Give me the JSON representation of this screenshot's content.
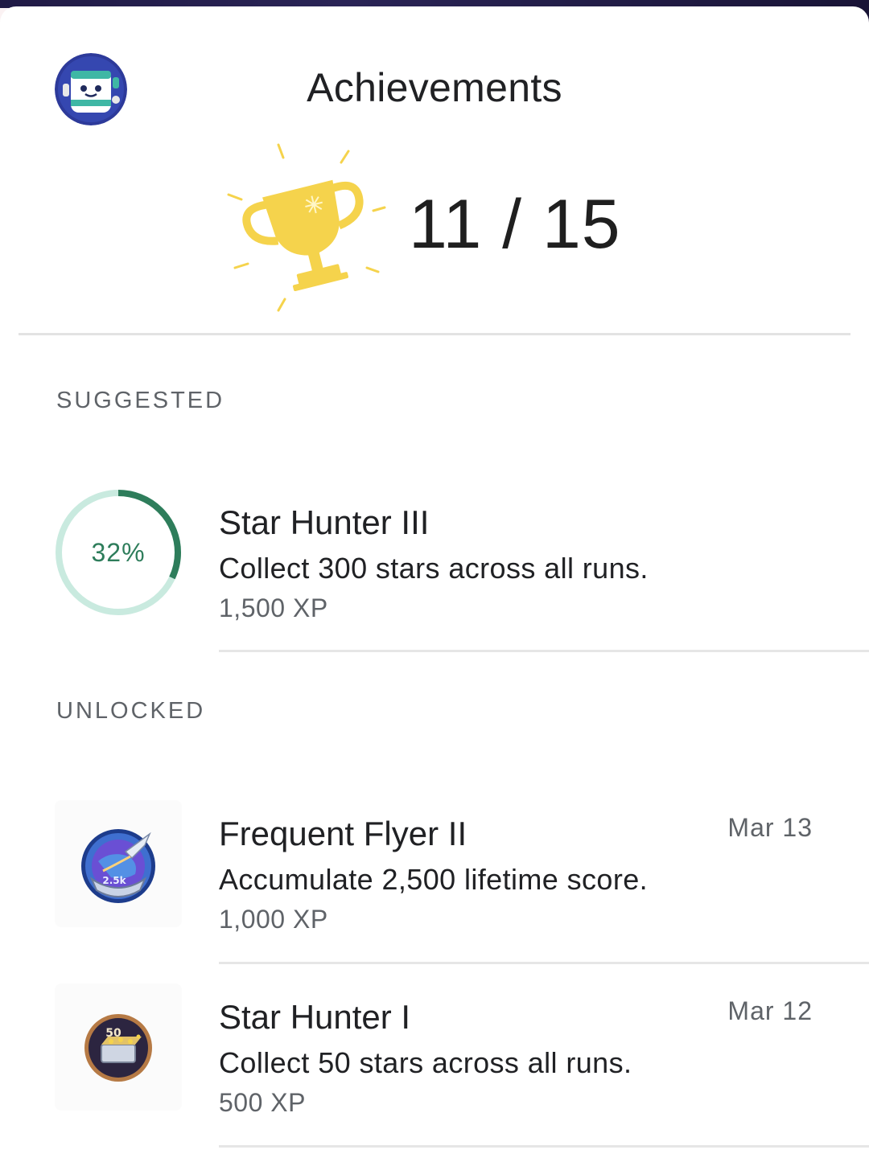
{
  "header": {
    "title": "Achievements",
    "unlocked_count": "11 / 15"
  },
  "colors": {
    "progress_fill": "#2e7d5b",
    "progress_track": "#c9eadf",
    "trophy_gold": "#f5d34c"
  },
  "icons": {
    "avatar": "robot-avatar-icon",
    "trophy": "trophy-icon"
  },
  "sections": {
    "suggested": {
      "label": "SUGGESTED",
      "items": [
        {
          "title": "Star Hunter III",
          "description": "Collect 300 stars across all runs.",
          "xp": "1,500 XP",
          "progress_label": "32%",
          "progress": 0.32
        }
      ]
    },
    "unlocked": {
      "label": "UNLOCKED",
      "items": [
        {
          "title": "Frequent Flyer II",
          "description": "Accumulate 2,500 lifetime score.",
          "xp": "1,000 XP",
          "date": "Mar 13",
          "badge": "rocket-globe-badge-icon",
          "badge_text": "2.5k"
        },
        {
          "title": "Star Hunter I",
          "description": "Collect 50 stars across all runs.",
          "xp": "500 XP",
          "date": "Mar 12",
          "badge": "treasure-chest-badge-icon",
          "badge_text": "50"
        }
      ]
    }
  }
}
